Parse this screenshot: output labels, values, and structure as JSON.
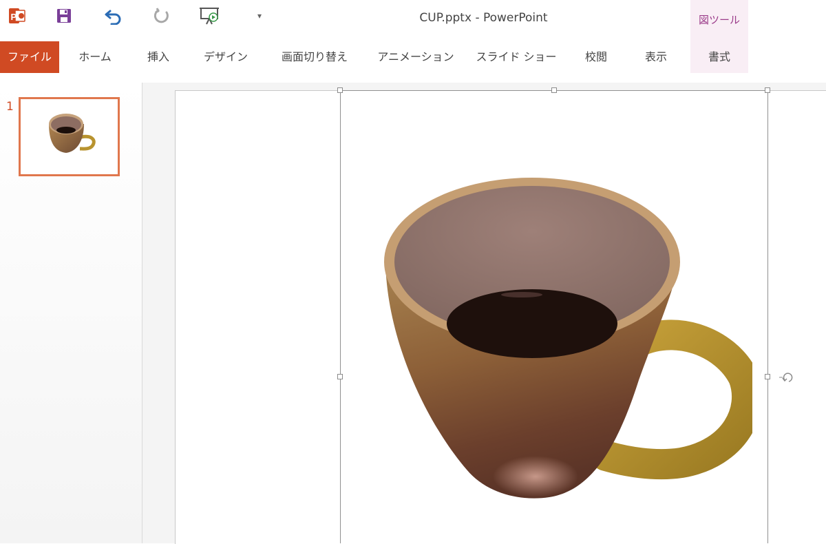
{
  "app": {
    "document_title": "CUP.pptx - PowerPoint",
    "contextual_tools_label": "図ツール"
  },
  "quick_access": {
    "app_icon": "powerpoint-icon",
    "save": "save-icon",
    "undo": "undo-icon",
    "redo": "redo-icon",
    "present": "start-slideshow-icon",
    "customize": "customize-qat-icon",
    "customize_glyph": "▾"
  },
  "ribbon": {
    "tabs": [
      {
        "label": "ファイル"
      },
      {
        "label": "ホーム"
      },
      {
        "label": "挿入"
      },
      {
        "label": "デザイン"
      },
      {
        "label": "画面切り替え"
      },
      {
        "label": "アニメーション"
      },
      {
        "label": "スライド ショー"
      },
      {
        "label": "校閲"
      },
      {
        "label": "表示"
      },
      {
        "label": "書式"
      }
    ]
  },
  "thumbnails": [
    {
      "number": "1",
      "selected": true
    }
  ],
  "colors": {
    "accent": "#d04a23",
    "thumb_border": "#e0774d",
    "tools_tab_bg": "#f9eef5",
    "tools_text": "#9b3c8a",
    "undo_blue": "#2b6cb5",
    "save_purple": "#7a3f98"
  }
}
